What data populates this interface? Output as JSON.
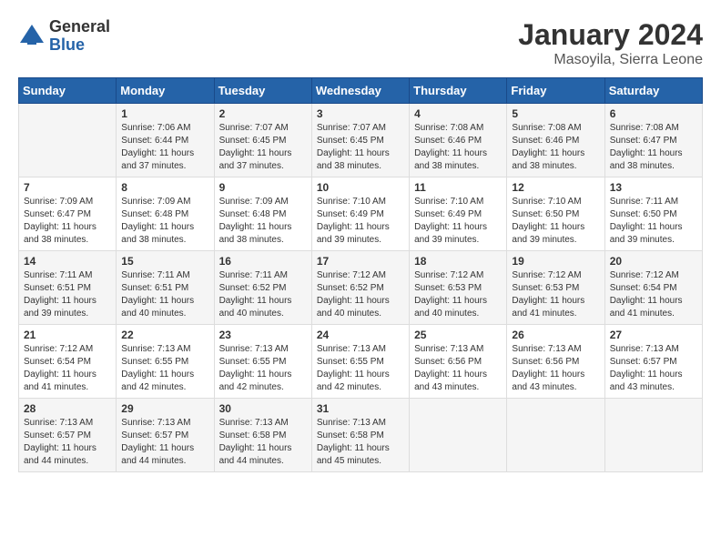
{
  "header": {
    "logo_general": "General",
    "logo_blue": "Blue",
    "month_title": "January 2024",
    "location": "Masoyila, Sierra Leone"
  },
  "days_of_week": [
    "Sunday",
    "Monday",
    "Tuesday",
    "Wednesday",
    "Thursday",
    "Friday",
    "Saturday"
  ],
  "weeks": [
    [
      {
        "day": "",
        "info": ""
      },
      {
        "day": "1",
        "info": "Sunrise: 7:06 AM\nSunset: 6:44 PM\nDaylight: 11 hours and 37 minutes."
      },
      {
        "day": "2",
        "info": "Sunrise: 7:07 AM\nSunset: 6:45 PM\nDaylight: 11 hours and 37 minutes."
      },
      {
        "day": "3",
        "info": "Sunrise: 7:07 AM\nSunset: 6:45 PM\nDaylight: 11 hours and 38 minutes."
      },
      {
        "day": "4",
        "info": "Sunrise: 7:08 AM\nSunset: 6:46 PM\nDaylight: 11 hours and 38 minutes."
      },
      {
        "day": "5",
        "info": "Sunrise: 7:08 AM\nSunset: 6:46 PM\nDaylight: 11 hours and 38 minutes."
      },
      {
        "day": "6",
        "info": "Sunrise: 7:08 AM\nSunset: 6:47 PM\nDaylight: 11 hours and 38 minutes."
      }
    ],
    [
      {
        "day": "7",
        "info": "Sunrise: 7:09 AM\nSunset: 6:47 PM\nDaylight: 11 hours and 38 minutes."
      },
      {
        "day": "8",
        "info": "Sunrise: 7:09 AM\nSunset: 6:48 PM\nDaylight: 11 hours and 38 minutes."
      },
      {
        "day": "9",
        "info": "Sunrise: 7:09 AM\nSunset: 6:48 PM\nDaylight: 11 hours and 38 minutes."
      },
      {
        "day": "10",
        "info": "Sunrise: 7:10 AM\nSunset: 6:49 PM\nDaylight: 11 hours and 39 minutes."
      },
      {
        "day": "11",
        "info": "Sunrise: 7:10 AM\nSunset: 6:49 PM\nDaylight: 11 hours and 39 minutes."
      },
      {
        "day": "12",
        "info": "Sunrise: 7:10 AM\nSunset: 6:50 PM\nDaylight: 11 hours and 39 minutes."
      },
      {
        "day": "13",
        "info": "Sunrise: 7:11 AM\nSunset: 6:50 PM\nDaylight: 11 hours and 39 minutes."
      }
    ],
    [
      {
        "day": "14",
        "info": "Sunrise: 7:11 AM\nSunset: 6:51 PM\nDaylight: 11 hours and 39 minutes."
      },
      {
        "day": "15",
        "info": "Sunrise: 7:11 AM\nSunset: 6:51 PM\nDaylight: 11 hours and 40 minutes."
      },
      {
        "day": "16",
        "info": "Sunrise: 7:11 AM\nSunset: 6:52 PM\nDaylight: 11 hours and 40 minutes."
      },
      {
        "day": "17",
        "info": "Sunrise: 7:12 AM\nSunset: 6:52 PM\nDaylight: 11 hours and 40 minutes."
      },
      {
        "day": "18",
        "info": "Sunrise: 7:12 AM\nSunset: 6:53 PM\nDaylight: 11 hours and 40 minutes."
      },
      {
        "day": "19",
        "info": "Sunrise: 7:12 AM\nSunset: 6:53 PM\nDaylight: 11 hours and 41 minutes."
      },
      {
        "day": "20",
        "info": "Sunrise: 7:12 AM\nSunset: 6:54 PM\nDaylight: 11 hours and 41 minutes."
      }
    ],
    [
      {
        "day": "21",
        "info": "Sunrise: 7:12 AM\nSunset: 6:54 PM\nDaylight: 11 hours and 41 minutes."
      },
      {
        "day": "22",
        "info": "Sunrise: 7:13 AM\nSunset: 6:55 PM\nDaylight: 11 hours and 42 minutes."
      },
      {
        "day": "23",
        "info": "Sunrise: 7:13 AM\nSunset: 6:55 PM\nDaylight: 11 hours and 42 minutes."
      },
      {
        "day": "24",
        "info": "Sunrise: 7:13 AM\nSunset: 6:55 PM\nDaylight: 11 hours and 42 minutes."
      },
      {
        "day": "25",
        "info": "Sunrise: 7:13 AM\nSunset: 6:56 PM\nDaylight: 11 hours and 43 minutes."
      },
      {
        "day": "26",
        "info": "Sunrise: 7:13 AM\nSunset: 6:56 PM\nDaylight: 11 hours and 43 minutes."
      },
      {
        "day": "27",
        "info": "Sunrise: 7:13 AM\nSunset: 6:57 PM\nDaylight: 11 hours and 43 minutes."
      }
    ],
    [
      {
        "day": "28",
        "info": "Sunrise: 7:13 AM\nSunset: 6:57 PM\nDaylight: 11 hours and 44 minutes."
      },
      {
        "day": "29",
        "info": "Sunrise: 7:13 AM\nSunset: 6:57 PM\nDaylight: 11 hours and 44 minutes."
      },
      {
        "day": "30",
        "info": "Sunrise: 7:13 AM\nSunset: 6:58 PM\nDaylight: 11 hours and 44 minutes."
      },
      {
        "day": "31",
        "info": "Sunrise: 7:13 AM\nSunset: 6:58 PM\nDaylight: 11 hours and 45 minutes."
      },
      {
        "day": "",
        "info": ""
      },
      {
        "day": "",
        "info": ""
      },
      {
        "day": "",
        "info": ""
      }
    ]
  ]
}
